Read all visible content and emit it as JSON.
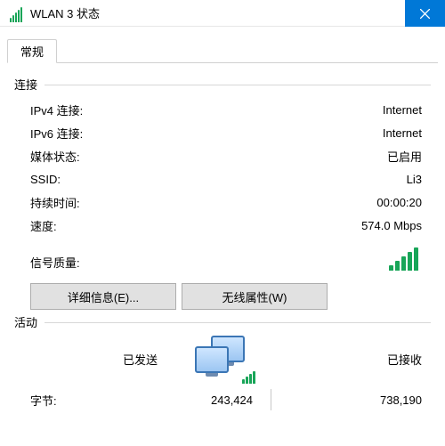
{
  "titlebar": {
    "title": "WLAN 3 状态"
  },
  "tabs": [
    {
      "label": "常规"
    }
  ],
  "connection_group": {
    "title": "连接",
    "rows": {
      "ipv4_label": "IPv4 连接:",
      "ipv4_value": "Internet",
      "ipv6_label": "IPv6 连接:",
      "ipv6_value": "Internet",
      "media_label": "媒体状态:",
      "media_value": "已启用",
      "ssid_label": "SSID:",
      "ssid_value": "Li3",
      "duration_label": "持续时间:",
      "duration_value": "00:00:20",
      "speed_label": "速度:",
      "speed_value": "574.0 Mbps",
      "signal_label": "信号质量:"
    },
    "buttons": {
      "details": "详细信息(E)...",
      "wireless_props": "无线属性(W)"
    }
  },
  "activity_group": {
    "title": "活动",
    "sent_label": "已发送",
    "received_label": "已接收",
    "bytes_label": "字节:",
    "bytes_sent": "243,424",
    "bytes_received": "738,190"
  },
  "icons": {
    "title_signal": "signal-strength-icon",
    "close": "close-icon",
    "monitors": "network-activity-monitors-icon"
  }
}
